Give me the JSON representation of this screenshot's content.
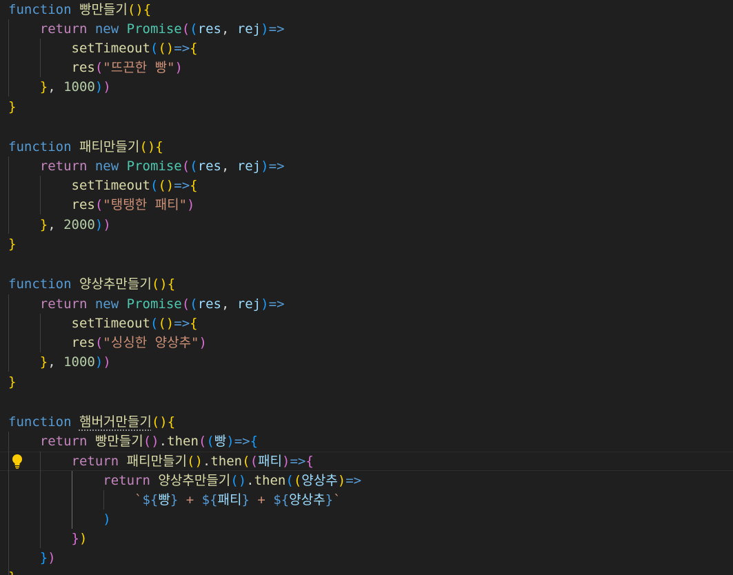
{
  "code": {
    "kw_function": "function",
    "kw_return": "return",
    "kw_new": "new",
    "promise": "Promise",
    "set_timeout": "setTimeout",
    "then": "then",
    "res": "res",
    "rej": "rej",
    "fn_bread": "빵만들기",
    "fn_patty": "패티만들기",
    "fn_lettuce": "양상추만들기",
    "fn_burger": "햄버거만들기",
    "str_bread": "\"뜨끈한 빵\"",
    "str_patty": "\"탱탱한 패티\"",
    "str_lettuce": "\"싱싱한 양상추\"",
    "num_1000": "1000",
    "num_2000": "2000",
    "p_bread": "빵",
    "p_patty": "패티",
    "p_lettuce": "양상추"
  },
  "colors": {
    "background": "#1f1f1f",
    "keyword": "#569cd6",
    "control": "#c586c0",
    "function": "#dcdcaa",
    "class": "#4ec9b0",
    "variable": "#9cdcfe",
    "string": "#ce9178",
    "number": "#b5cea8",
    "bracket_1": "#ffd700",
    "bracket_2": "#da70d6",
    "bracket_3": "#179fff"
  },
  "icons": {
    "gutter": "lightbulb-icon"
  }
}
